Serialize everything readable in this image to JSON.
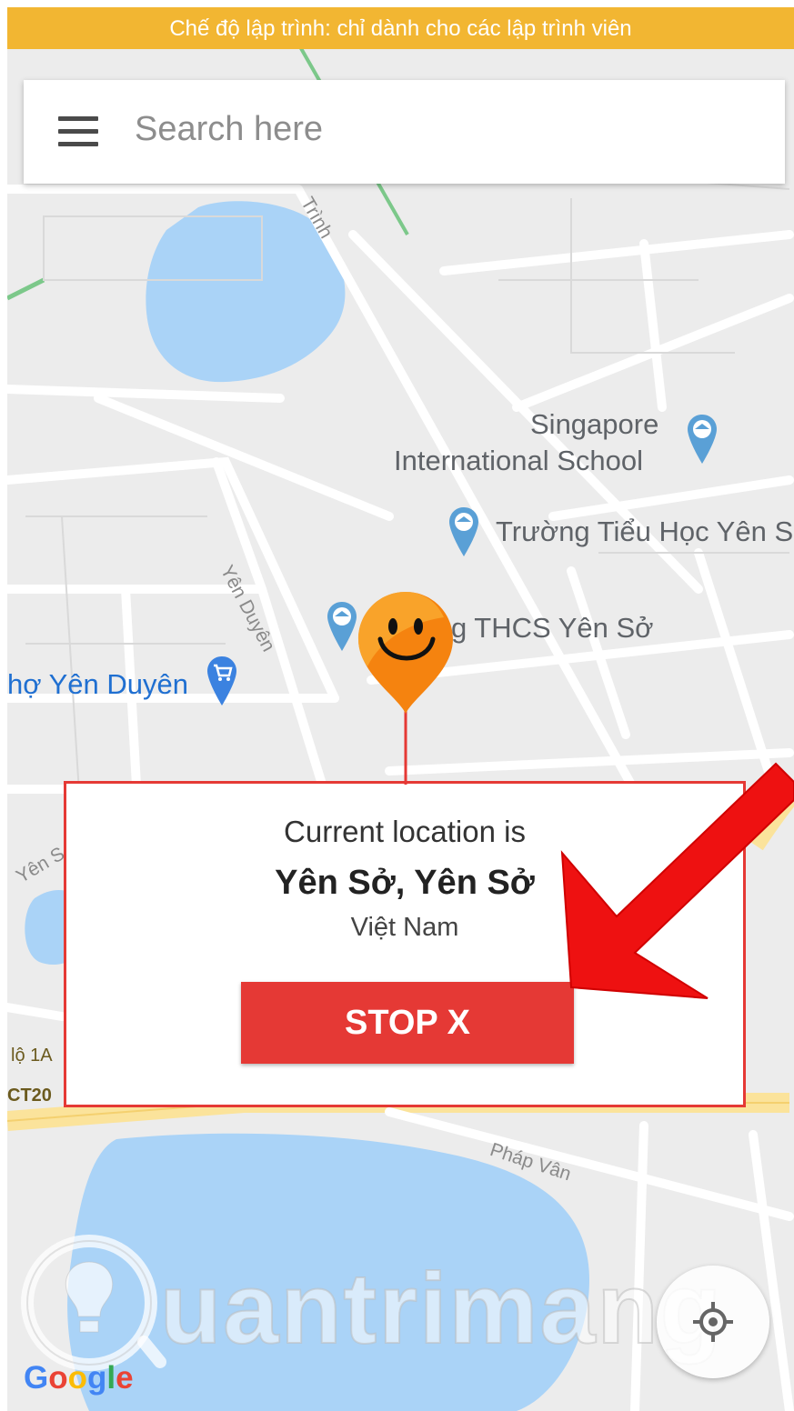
{
  "dev_banner": "Chế độ lập trình: chỉ dành cho các lập trình viên",
  "search": {
    "placeholder": "Search here"
  },
  "map_labels": {
    "poi_singapore_1": "Singapore",
    "poi_singapore_2": "International School",
    "poi_truong_tieu_hoc": "Trường Tiểu Học Yên S",
    "poi_thcs": "g THCS Yên Sở",
    "poi_cho": "hợ Yên Duyên",
    "street_yen_duyen": "Yên Duyên",
    "street_trinh": "Trình",
    "street_phap_van": "Pháp Vân",
    "street_yen_so": "Yên S",
    "road_ql1a": "lộ 1A",
    "road_ct20": "CT20"
  },
  "popup": {
    "title": "Current location is",
    "location_name": "Yên Sở, Yên Sở",
    "country": "Việt Nam",
    "stop_label": "STOP  X"
  },
  "watermark_text": "uantrimang",
  "google_logo": {
    "G": "G",
    "o1": "o",
    "o2": "o",
    "g": "g",
    "l": "l",
    "e": "e"
  },
  "colors": {
    "banner": "#f2b632",
    "accent_red": "#e53935",
    "water": "#aad3f7",
    "poi_blue": "#1f6fd1"
  }
}
